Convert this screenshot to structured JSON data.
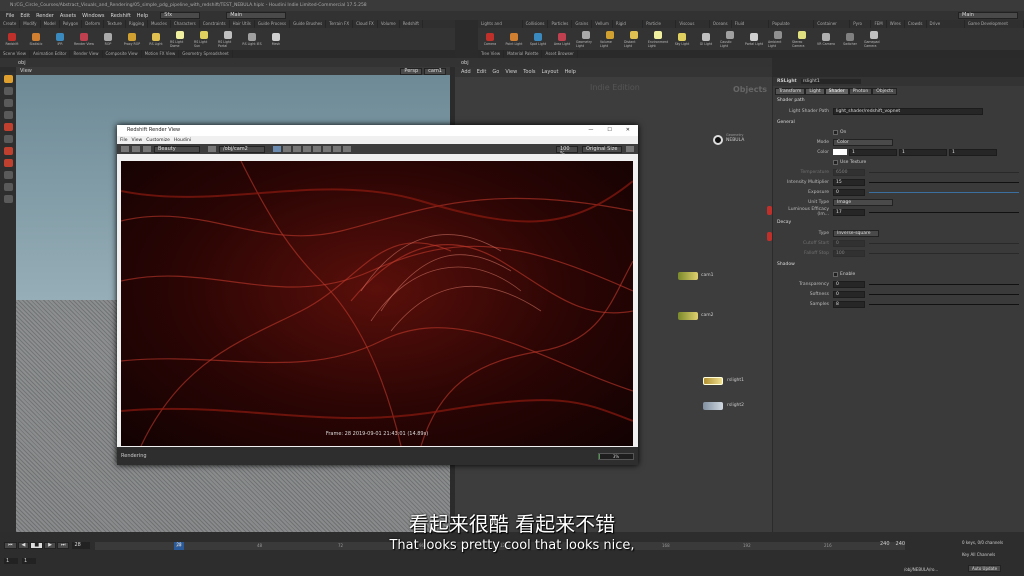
{
  "app": {
    "title": "N:/CG_Circle_Courses/Abstract_Visuals_and_Rendering/05_simple_pdg_pipeline_with_redshift/TEST_NEBULA.hiplc - Houdini Indie Limited-Commercial 17.5.258"
  },
  "menu": [
    "File",
    "Edit",
    "Render",
    "Assets",
    "Windows",
    "Redshift",
    "Help"
  ],
  "desktop": {
    "name": "Sfx",
    "main": "Main"
  },
  "shelf_tabs_left": [
    "Create",
    "Modify",
    "Model",
    "Polygon",
    "Deform",
    "Texture",
    "Rigging",
    "Muscles",
    "Characters",
    "Constraints",
    "Hair Utils",
    "Guide Process",
    "Guide Brushes",
    "Terrain FX",
    "Cloud FX",
    "Volume",
    "Redshift"
  ],
  "shelf_tabs_right": [
    "Lights and Cameras",
    "Collisions",
    "Particles",
    "Grains",
    "Vellum",
    "Rigid Bodies",
    "Particle Fluids",
    "Viscous Fluids",
    "Oceans",
    "Fluid Containers",
    "Populate Containers",
    "Container Tools",
    "Pyro FX",
    "FEM",
    "Wires",
    "Crowds",
    "Drive Simulation",
    "Game Development Toolset"
  ],
  "left_tools": [
    "Redshift",
    "Statistic",
    "IPR",
    "Render View",
    "ROP",
    "Proxy ROP",
    "RS Light",
    "RS Light Dome",
    "RS Light Sun",
    "RS Light Portal",
    "RS Light IES",
    "Mesh"
  ],
  "right_tools": [
    "Camera",
    "Point Light",
    "Spot Light",
    "Area Light",
    "Geometry Light",
    "Volume Light",
    "Distant Light",
    "Environment Light",
    "Sky Light",
    "GI Light",
    "Caustic Light",
    "Portal Light",
    "Ambient Light",
    "Stereo Camera",
    "VR Camera",
    "Switcher",
    "Gamepad Camera"
  ],
  "left_tabs": [
    "Scene View",
    "Animation Editor",
    "Render View",
    "Composite View",
    "Motion FX View",
    "Geometry Spreadsheet"
  ],
  "right_tabs": [
    "Tree View",
    "Material Palette",
    "Asset Browser"
  ],
  "viewport": {
    "path": "obj",
    "label": "View",
    "persp": "Persp",
    "cam": "cam1"
  },
  "network": {
    "path": "obj",
    "menu": [
      "Add",
      "Edit",
      "Go",
      "View",
      "Tools",
      "Layout",
      "Help"
    ],
    "watermark": "Indie Edition",
    "context": "Objects",
    "nodes": [
      {
        "name": "NEBULA",
        "sub": "Geometry"
      },
      {
        "name": "cam1"
      },
      {
        "name": "cam2"
      },
      {
        "name": "rslight1"
      },
      {
        "name": "rslight2"
      }
    ]
  },
  "params": {
    "node_type": "RSLight",
    "node_name": "rslight1",
    "tabs": [
      "Transform",
      "Light",
      "Shader",
      "Photon",
      "Objects"
    ],
    "shader_path_section": "Shader path",
    "light_shader_path_label": "Light Shader Path",
    "light_shader_path_value": "light_shader/redshift_vopnet",
    "general_section": "General",
    "on_label": "On",
    "mode_label": "Mode",
    "mode_value": "Color",
    "color_label": "Color",
    "color_values": [
      "1",
      "1",
      "1"
    ],
    "use_texture": "Use Texture",
    "temperature_label": "Temperature",
    "temperature_value": "6500",
    "intensity_label": "Intensity Multiplier",
    "intensity_value": "15",
    "exposure_label": "Exposure",
    "exposure_value": "0",
    "unit_type_label": "Unit Type",
    "unit_type_value": "Image",
    "luminous_label": "Luminous Efficacy (lm...",
    "luminous_value": "17",
    "decay_section": "Decay",
    "type_label": "Type",
    "type_value": "Inverse-square",
    "cutoff_start_label": "Cutoff Start",
    "cutoff_start_value": "0",
    "falloff_stop_label": "Falloff Stop",
    "falloff_stop_value": "100",
    "shadow_section": "Shadow",
    "enable_label": "Enable",
    "transparency_label": "Transparency",
    "transparency_value": "0",
    "softness_label": "Softness",
    "softness_value": "0",
    "samples_label": "Samples",
    "samples_value": "8"
  },
  "render_view": {
    "title": "Redshift Render View",
    "menu": [
      "File",
      "View",
      "Customize",
      "Houdini"
    ],
    "aov": "Beauty",
    "camera": "/obj/cam2",
    "zoom": "100 %",
    "size": "Original Size",
    "frame_info": "Frame: 28  2019-09-01  21:43:01  (14.89s)",
    "status": "Rendering",
    "progress_label": "3%",
    "progress": 0.03
  },
  "timeline": {
    "frame": "28",
    "start": "1",
    "start2": "1",
    "end": "240",
    "end2": "240",
    "ticks": [
      "24",
      "48",
      "72",
      "96",
      "120",
      "144",
      "168",
      "192",
      "216"
    ],
    "keys_label": "0 keys, 0/0 channels",
    "channels": "Key All Channels",
    "auto_update": "Auto Update",
    "path": "/obj/NEBULA/ro..."
  },
  "subtitles": {
    "zh": "看起来很酷 看起来不错",
    "en": "That looks pretty cool that looks nice,"
  },
  "colors": {
    "accent_yellow": "#e0d070",
    "render_red": "#c0392b"
  }
}
